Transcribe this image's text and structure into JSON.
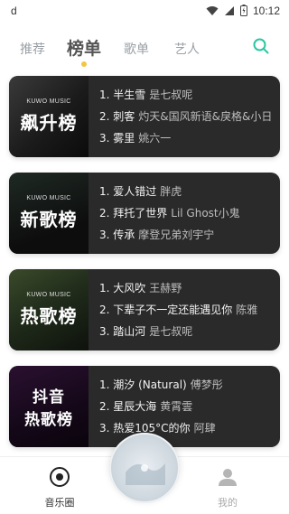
{
  "status_bar": {
    "left": "d",
    "time": "10:12"
  },
  "tabs": [
    {
      "label": "推荐",
      "active": false
    },
    {
      "label": "榜单",
      "active": true
    },
    {
      "label": "歌单",
      "active": false
    },
    {
      "label": "艺人",
      "active": false
    }
  ],
  "charts": [
    {
      "cover_brand": "KUWO MUSIC",
      "cover_title": "飙升榜",
      "tracks": [
        {
          "title": "1. 半生雪",
          "artist": "是七叔呢"
        },
        {
          "title": "2. 刺客",
          "artist": "灼天&国风新语&戾格&小日"
        },
        {
          "title": "3. 雾里",
          "artist": "姚六一"
        }
      ]
    },
    {
      "cover_brand": "KUWO MUSIC",
      "cover_title": "新歌榜",
      "tracks": [
        {
          "title": "1. 爱人错过",
          "artist": "胖虎"
        },
        {
          "title": "2. 拜托了世界",
          "artist": "Lil Ghost小鬼"
        },
        {
          "title": "3. 传承",
          "artist": "摩登兄弟刘宇宁"
        }
      ]
    },
    {
      "cover_brand": "KUWO MUSIC",
      "cover_title": "热歌榜",
      "tracks": [
        {
          "title": "1. 大风吹",
          "artist": "王赫野"
        },
        {
          "title": "2. 下辈子不一定还能遇见你",
          "artist": "陈雅"
        },
        {
          "title": "3. 踏山河",
          "artist": "是七叔呢"
        }
      ]
    },
    {
      "cover_brand": "抖音",
      "cover_title": "热歌榜",
      "tracks": [
        {
          "title": "1. 潮汐 (Natural)",
          "artist": "傅梦彤"
        },
        {
          "title": "2. 星辰大海",
          "artist": "黄霄雲"
        },
        {
          "title": "3. 热爱105°C的你",
          "artist": "阿肆"
        }
      ]
    }
  ],
  "bottom_nav": {
    "music_label": "音乐圈",
    "mine_label": "我的"
  },
  "colors": {
    "accent_dot": "#f3c542",
    "search_icon": "#2bc6a3",
    "card_bg": "#2a2a2a"
  }
}
